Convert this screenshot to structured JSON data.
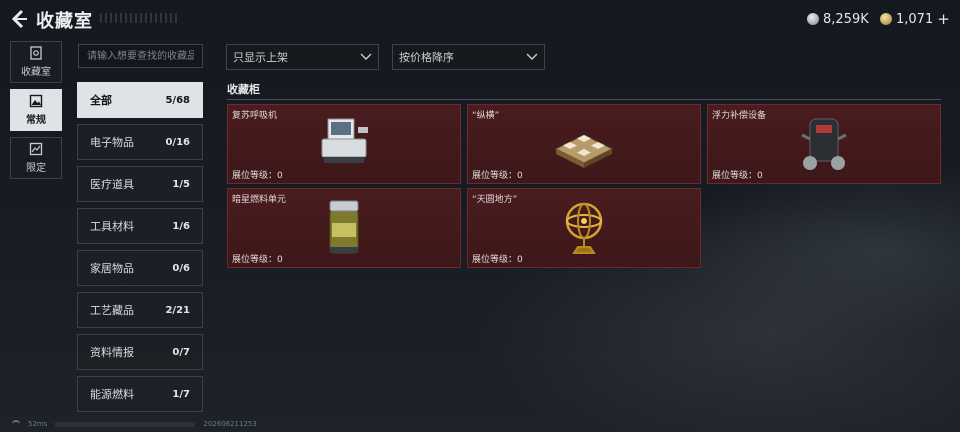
{
  "header": {
    "title": "收藏室",
    "back_icon": "back-arrow-icon"
  },
  "currencies": [
    {
      "icon": "silver-coin-icon",
      "value": "8,259K"
    },
    {
      "icon": "gold-coin-icon",
      "value": "1,071",
      "add": "+"
    }
  ],
  "rail": [
    {
      "label": "收藏室",
      "icon": "vault-icon",
      "active": false
    },
    {
      "label": "常规",
      "icon": "picture-icon",
      "active": true
    },
    {
      "label": "限定",
      "icon": "limited-icon",
      "active": false
    }
  ],
  "search": {
    "placeholder": "请输入想要查找的收藏品"
  },
  "filters": {
    "shelf": "只显示上架",
    "sort": "按价格降序"
  },
  "categories": [
    {
      "label": "全部",
      "count": "5/68",
      "active": true
    },
    {
      "label": "电子物品",
      "count": "0/16"
    },
    {
      "label": "医疗道具",
      "count": "1/5"
    },
    {
      "label": "工具材料",
      "count": "1/6"
    },
    {
      "label": "家居物品",
      "count": "0/6"
    },
    {
      "label": "工艺藏品",
      "count": "2/21"
    },
    {
      "label": "资料情报",
      "count": "0/7"
    },
    {
      "label": "能源燃料",
      "count": "1/7"
    }
  ],
  "section": {
    "title": "收藏柜"
  },
  "cards": [
    {
      "name": "复苏呼吸机",
      "level": "展位等级：0",
      "art": "respirator-icon"
    },
    {
      "name": "“纵横”",
      "level": "展位等级：0",
      "art": "chessboard-icon"
    },
    {
      "name": "浮力补偿设备",
      "level": "展位等级：0",
      "art": "buoyancy-device-icon"
    },
    {
      "name": "暗星燃料单元",
      "level": "展位等级：0",
      "art": "fuel-cell-icon"
    },
    {
      "name": "“天圆地方”",
      "level": "展位等级：0",
      "art": "armillary-sphere-icon"
    }
  ],
  "status": {
    "ping": "52ms",
    "stamp": "202606211253"
  },
  "colors": {
    "card_bg": "#4a1c1f",
    "card_border": "#6b2b2e",
    "active_bg": "#dfe3e6"
  }
}
